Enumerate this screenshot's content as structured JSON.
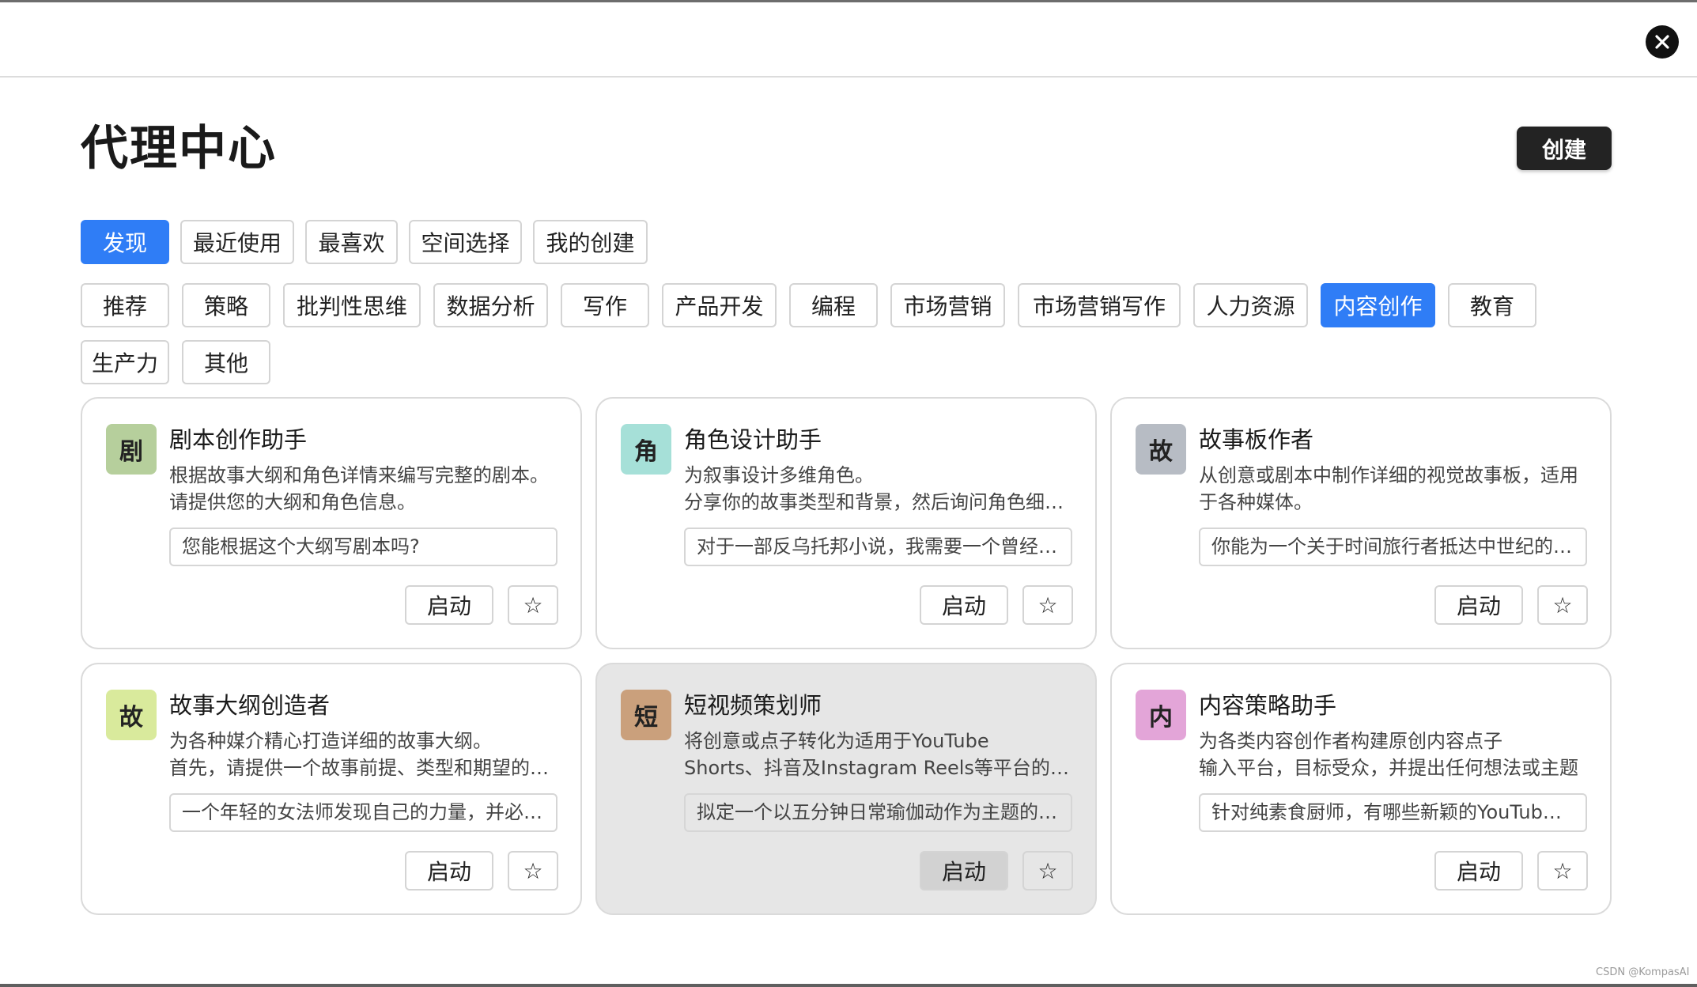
{
  "header": {
    "close_icon": "close-icon"
  },
  "page": {
    "title": "代理中心",
    "create_label": "创建"
  },
  "tabs": [
    {
      "label": "发现",
      "active": true
    },
    {
      "label": "最近使用",
      "active": false
    },
    {
      "label": "最喜欢",
      "active": false
    },
    {
      "label": "空间选择",
      "active": false
    },
    {
      "label": "我的创建",
      "active": false
    }
  ],
  "categories": [
    {
      "label": "推荐",
      "active": false
    },
    {
      "label": "策略",
      "active": false
    },
    {
      "label": "批判性思维",
      "active": false
    },
    {
      "label": "数据分析",
      "active": false
    },
    {
      "label": "写作",
      "active": false
    },
    {
      "label": "产品开发",
      "active": false
    },
    {
      "label": "编程",
      "active": false
    },
    {
      "label": "市场营销",
      "active": false
    },
    {
      "label": "市场营销写作",
      "active": false
    },
    {
      "label": "人力资源",
      "active": false
    },
    {
      "label": "内容创作",
      "active": true
    },
    {
      "label": "教育",
      "active": false
    },
    {
      "label": "生产力",
      "active": false
    },
    {
      "label": "其他",
      "active": false
    }
  ],
  "agents": [
    {
      "avatar": "剧",
      "avatar_color": "#b6cf9c",
      "name": "剧本创作助手",
      "desc_1": "根据故事大纲和角色详情来编写完整的剧本。",
      "desc_2": "请提供您的大纲和角色信息。",
      "prompt": "您能根据这个大纲写剧本吗?",
      "launch": "启动",
      "star": "☆"
    },
    {
      "avatar": "角",
      "avatar_color": "#a6e0d8",
      "name": "角色设计助手",
      "desc_1": "为叙事设计多维角色。",
      "desc_2": "分享你的故事类型和背景，然后询问角色细…",
      "prompt": "对于一部反乌托邦小说，我需要一个曾经…",
      "launch": "启动",
      "star": "☆"
    },
    {
      "avatar": "故",
      "avatar_color": "#b7bcc4",
      "name": "故事板作者",
      "desc_1": "从创意或剧本中制作详细的视觉故事板，适用",
      "desc_2": "于各种媒体。",
      "prompt": "你能为一个关于时间旅行者抵达中世纪的…",
      "launch": "启动",
      "star": "☆"
    },
    {
      "avatar": "故",
      "avatar_color": "#d9ea9c",
      "name": "故事大纲创造者",
      "desc_1": "为各种媒介精心打造详细的故事大纲。",
      "desc_2": "首先，请提供一个故事前提、类型和期望的…",
      "prompt": "一个年轻的女法师发现自己的力量，并必…",
      "launch": "启动",
      "star": "☆"
    },
    {
      "avatar": "短",
      "avatar_color": "#caa07c",
      "name": "短视频策划师",
      "desc_1": "将创意或点子转化为适用于YouTube",
      "desc_2": "Shorts、抖音及Instagram Reels等平台的短…",
      "prompt": "拟定一个以五分钟日常瑜伽动作为主题的…",
      "launch": "启动",
      "star": "☆",
      "hovered": true
    },
    {
      "avatar": "内",
      "avatar_color": "#e3a5d8",
      "name": "内容策略助手",
      "desc_1": "为各类内容创作者构建原创内容点子",
      "desc_2": "输入平台，目标受众，并提出任何想法或主题",
      "prompt": "针对纯素食厨师，有哪些新颖的YouTub…",
      "launch": "启动",
      "star": "☆"
    }
  ],
  "watermark": "CSDN @KompasAI"
}
